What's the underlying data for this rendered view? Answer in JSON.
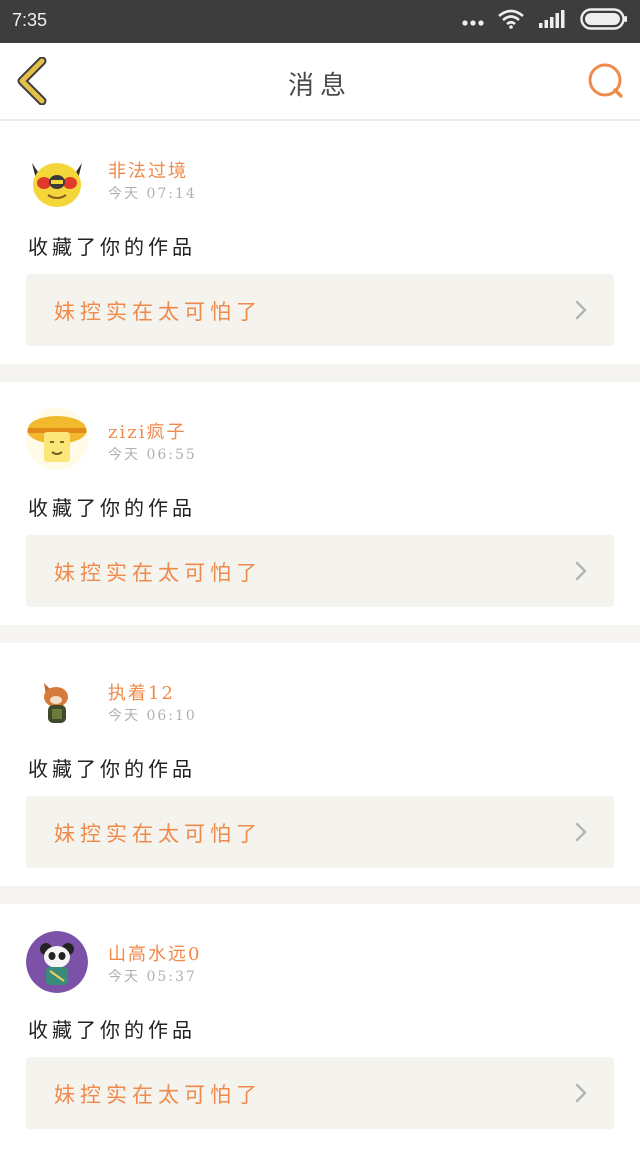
{
  "statusbar": {
    "time": "7:35"
  },
  "header": {
    "title": "消息"
  },
  "messages": [
    {
      "username": "非法过境",
      "time": "今天 07:14",
      "action": "收藏了你的作品",
      "work_title": "妹控实在太可怕了",
      "avatar": "pikachu-avatar"
    },
    {
      "username": "zizi疯子",
      "time": "今天 06:55",
      "action": "收藏了你的作品",
      "work_title": "妹控实在太可怕了",
      "avatar": "yellow-character-avatar"
    },
    {
      "username": "执着12",
      "time": "今天 06:10",
      "action": "收藏了你的作品",
      "work_title": "妹控实在太可怕了",
      "avatar": "fox-character-avatar"
    },
    {
      "username": "山高水远0",
      "time": "今天 05:37",
      "action": "收藏了你的作品",
      "work_title": "妹控实在太可怕了",
      "avatar": "panda-purple-avatar"
    }
  ],
  "colors": {
    "accent": "#f08a4b",
    "back_arrow": "#e2c04a",
    "statusbar": "#3d3d3d",
    "work_bg": "#f4f3ee"
  }
}
